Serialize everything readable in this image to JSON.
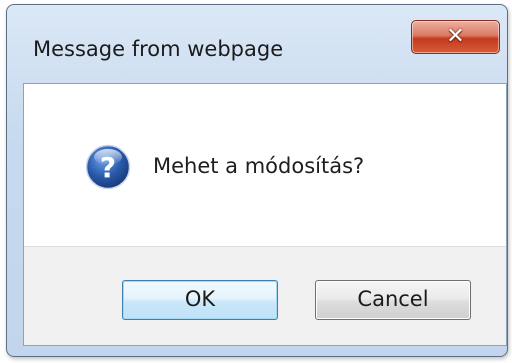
{
  "window": {
    "title": "Message from webpage",
    "close_icon": "close-icon"
  },
  "message": {
    "icon": "question-icon",
    "text": "Mehet a módosítás?"
  },
  "buttons": {
    "ok_label": "OK",
    "cancel_label": "Cancel"
  },
  "colors": {
    "frame": "#c6d9ee",
    "close_button": "#c43b1f",
    "ok_button_border": "#3c7fb1",
    "question_icon": "#2b5cae"
  }
}
